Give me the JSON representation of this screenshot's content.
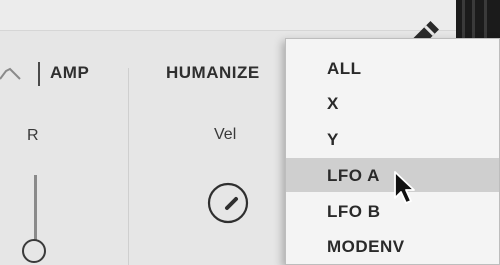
{
  "amp_section": {
    "title": "AMP",
    "param_label": "R"
  },
  "humanize_section": {
    "title": "HUMANIZE",
    "param_label": "Vel"
  },
  "dropdown": {
    "items": [
      {
        "label": "ALL"
      },
      {
        "label": "X"
      },
      {
        "label": "Y"
      },
      {
        "label": "LFO A",
        "hovered": true
      },
      {
        "label": "LFO B"
      },
      {
        "label": "MODENV"
      }
    ]
  },
  "icons": {
    "wave": "amp-waveform-icon",
    "pen": "edit-pen-icon",
    "cursor": "mouse-pointer-icon"
  },
  "colors": {
    "panel_bg": "#e6e6e6",
    "menu_bg": "#f4f4f4",
    "menu_hover": "#cfcfcf",
    "text": "#2a2a2a"
  }
}
